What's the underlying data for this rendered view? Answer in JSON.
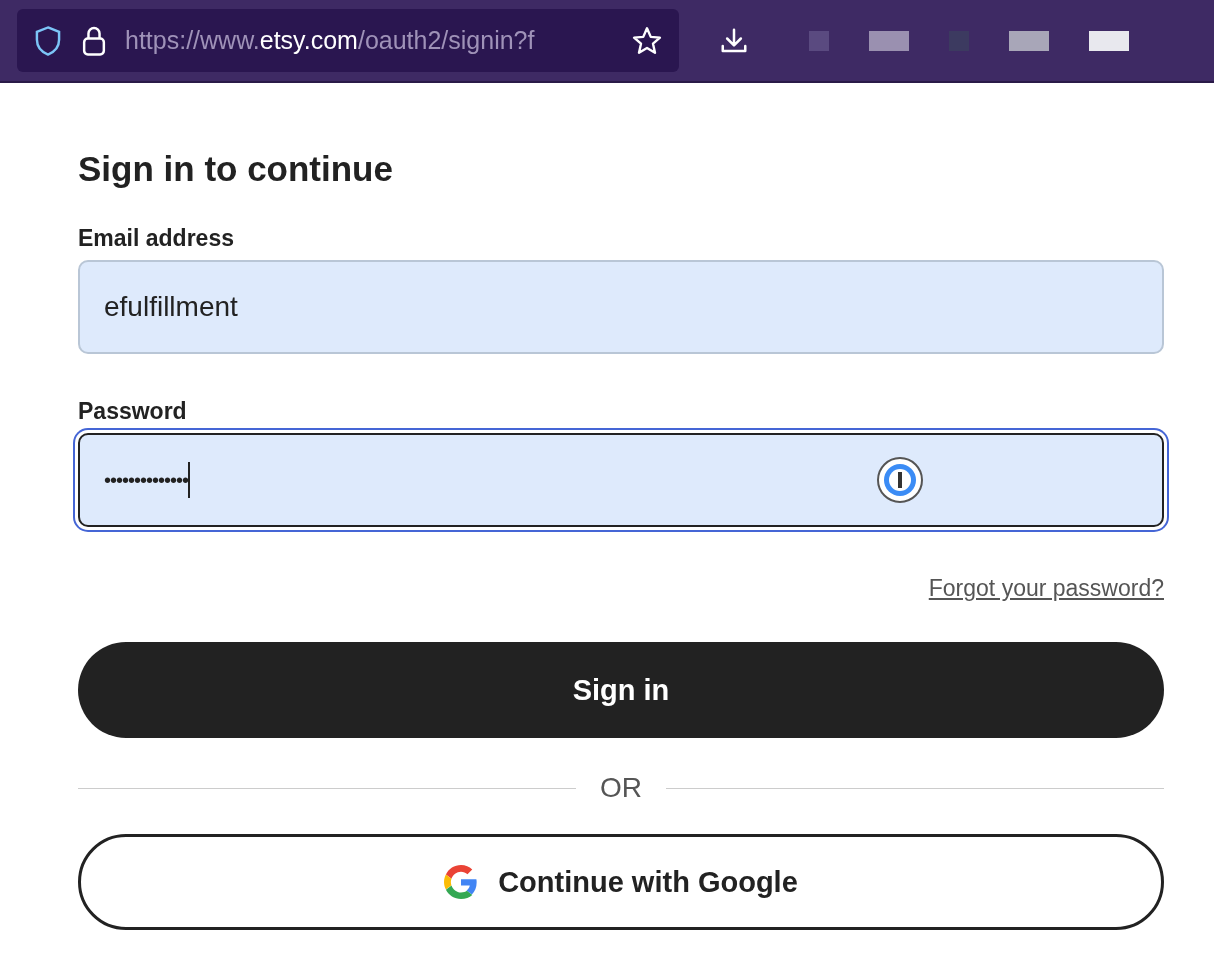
{
  "browser": {
    "url": {
      "prefix": "https://www.",
      "host": "etsy.com",
      "path": "/oauth2/signin?f"
    }
  },
  "form": {
    "title": "Sign in to continue",
    "fields": [
      {
        "label": "Email address",
        "value": "efulfillment",
        "focused": false,
        "kind": "text"
      },
      {
        "label": "Password",
        "value": "••••••••••••••",
        "focused": true,
        "kind": "password"
      }
    ],
    "forgot_link": "Forgot your password?",
    "sign_in_button": "Sign in",
    "divider": "OR",
    "google_button": "Continue with Google"
  }
}
